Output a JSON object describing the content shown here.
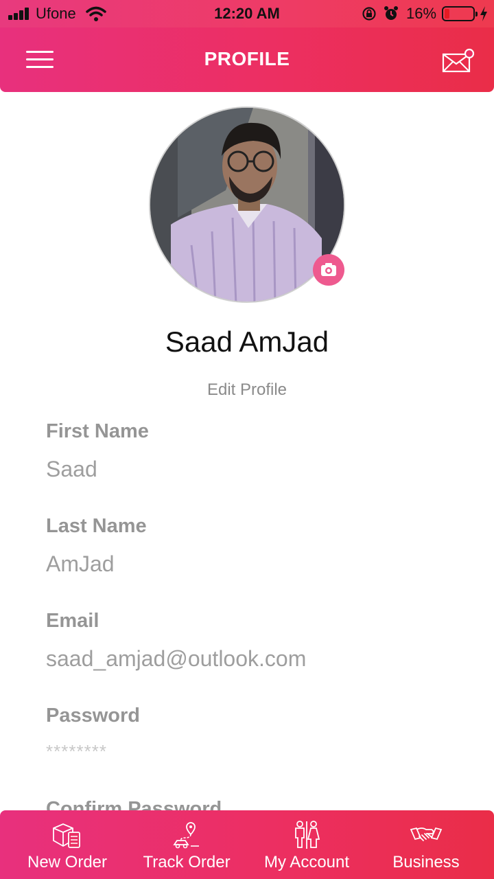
{
  "status_bar": {
    "carrier": "Ufone",
    "time": "12:20 AM",
    "battery_percent": "16%",
    "battery_level": 0.16,
    "icons": [
      "signal-icon",
      "wifi-icon",
      "rotation-lock-icon",
      "alarm-icon",
      "battery-icon",
      "charging-bolt-icon"
    ]
  },
  "header": {
    "title": "PROFILE",
    "menu_icon": "hamburger-menu-icon",
    "mail_icon": "mail-notification-icon"
  },
  "profile": {
    "name": "Saad AmJad",
    "edit_label": "Edit Profile",
    "camera_icon": "camera-icon"
  },
  "fields": [
    {
      "label": "First Name",
      "value": "Saad"
    },
    {
      "label": "Last Name",
      "value": "AmJad"
    },
    {
      "label": "Email",
      "value": "saad_amjad@outlook.com"
    },
    {
      "label": "Password",
      "value": "********"
    },
    {
      "label": "Confirm Password",
      "value": ""
    }
  ],
  "bottom_nav": [
    {
      "label": "New Order",
      "icon": "package-checklist-icon"
    },
    {
      "label": "Track Order",
      "icon": "delivery-route-icon"
    },
    {
      "label": "My Account",
      "icon": "users-icon"
    },
    {
      "label": "Business",
      "icon": "handshake-icon"
    }
  ],
  "colors": {
    "accent_start": "#e8307d",
    "accent_end": "#ea2d48",
    "label_gray": "#959595",
    "value_gray": "#9e9e9e"
  }
}
